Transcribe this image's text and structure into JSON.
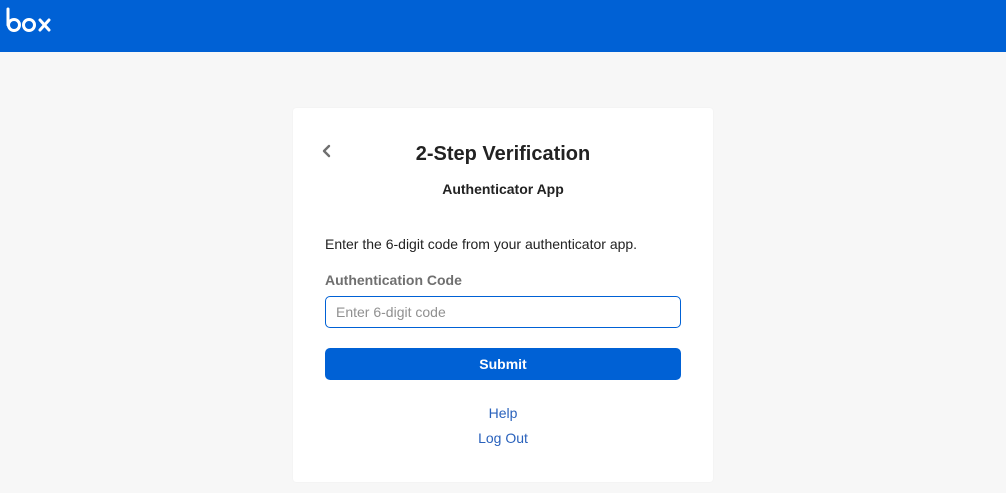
{
  "header": {
    "logo_text": "box",
    "brand_color": "#0061d5"
  },
  "card": {
    "back_icon": "chevron-left-icon",
    "title": "2-Step Verification",
    "subtitle": "Authenticator App",
    "instructions": "Enter the 6-digit code from your authenticator app.",
    "field_label": "Authentication Code",
    "code_input": {
      "value": "",
      "placeholder": "Enter 6-digit code"
    },
    "submit_label": "Submit",
    "help_link": "Help",
    "logout_link": "Log Out"
  }
}
